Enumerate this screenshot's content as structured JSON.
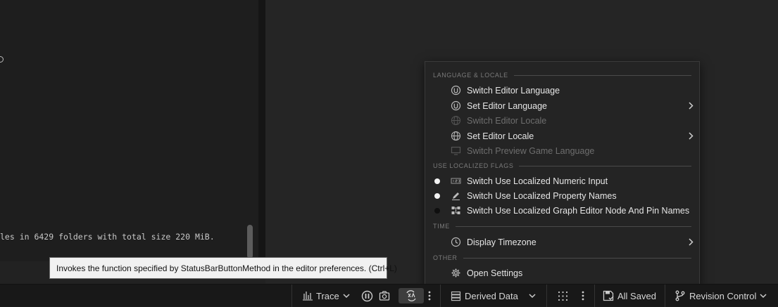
{
  "log": {
    "text": "les in 6429 folders with total size 220 MiB."
  },
  "tooltip": {
    "text": "Invokes the function specified by StatusBarButtonMethod in the editor preferences. (Ctrl+L)"
  },
  "menu": {
    "sections": {
      "language": "LANGUAGE & LOCALE",
      "flags": "USE LOCALIZED FLAGS",
      "time": "TIME",
      "other": "OTHER"
    },
    "items": {
      "switch_editor_language": "Switch Editor Language",
      "set_editor_language": "Set Editor Language",
      "switch_editor_locale": "Switch Editor Locale",
      "set_editor_locale": "Set Editor Locale",
      "switch_preview_game_language": "Switch Preview Game Language",
      "numeric_input": "Switch Use Localized Numeric Input",
      "property_names": "Switch Use Localized Property Names",
      "graph_editor": "Switch Use Localized Graph Editor Node And Pin Names",
      "display_timezone": "Display Timezone",
      "open_settings": "Open Settings"
    }
  },
  "statusbar": {
    "trace": "Trace",
    "derived_data": "Derived Data",
    "all_saved": "All Saved",
    "revision_control": "Revision Control"
  },
  "colors": {
    "accent_selected": "#3d3d3d",
    "tooltip_bg": "#f1f1f1",
    "menu_bg": "#242424"
  }
}
